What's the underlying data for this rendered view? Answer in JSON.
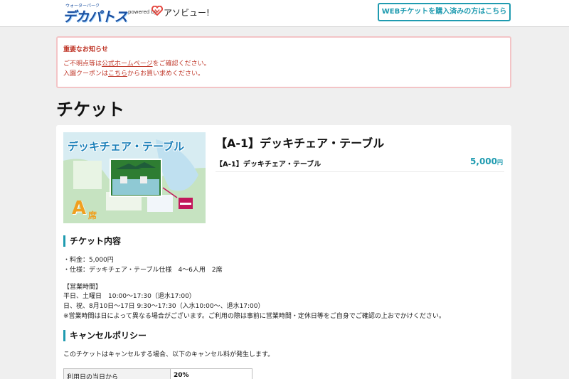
{
  "header": {
    "logo_small": "ウォーターパーク",
    "logo_main": "デカパトス",
    "powered_by": "powered by",
    "asoview_text": "アソビュー!",
    "web_ticket_button": "WEBチケットを購入済みの方はこちら"
  },
  "notice": {
    "title": "重要なお知らせ",
    "line1_pre": "ご不明点等は",
    "line1_link": "公式ホームページ",
    "line1_post": "をご確認ください。",
    "line2_pre": "入園クーポンは",
    "line2_link": "こちら",
    "line2_post": "からお買い求めください。"
  },
  "page_title": "チケット",
  "product": {
    "image_banner": "デッキチェア・テーブル",
    "image_grade": "A",
    "image_grade_suffix": "席",
    "title": "【A-1】デッキチェア・テーブル",
    "variant_name": "【A-1】デッキチェア・テーブル",
    "variant_price": "5,000",
    "variant_price_unit": "円"
  },
  "details": {
    "heading": "チケット内容",
    "price_line": "・料金：5,000円",
    "spec_line": "・仕様：デッキチェア・テーブル仕様　4〜6人用　2席",
    "hours_heading": "【営業時間】",
    "hours_line1": "平日、土曜日　10:00〜17:30（退水17:00）",
    "hours_line2": "日、祝、8月10日〜17日 9:30〜17:30（入水10:00〜、退水17:00）",
    "hours_note": "※営業時間は日によって異なる場合がございます。ご利用の際は事前に営業時間・定休日等をご自身でご確認の上おでかけください。"
  },
  "cancel": {
    "heading": "キャンセルポリシー",
    "description": "このチケットはキャンセルする場合、以下のキャンセル料が発生します。",
    "rows": [
      {
        "label": "利用日の当日から",
        "value": "20%"
      }
    ]
  },
  "colors": {
    "accent": "#1f9bb0",
    "notice_text": "#c0392b",
    "notice_border": "#f3c4c6",
    "brand_blue": "#1a4fa0",
    "grade_orange": "#f0a020"
  }
}
